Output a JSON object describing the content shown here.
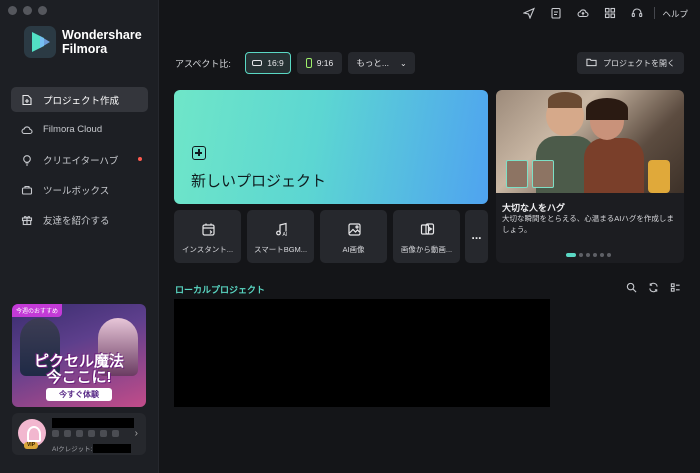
{
  "app": {
    "logo_line1": "Wondershare",
    "logo_line2": "Filmora",
    "help_label": "ヘルプ",
    "accent_color": "#5ad8c4"
  },
  "sidebar": {
    "items": [
      {
        "label": "プロジェクト作成",
        "icon": "project-create-icon",
        "active": true
      },
      {
        "label": "Filmora Cloud",
        "icon": "cloud-icon"
      },
      {
        "label": "クリエイターハブ",
        "icon": "lightbulb-icon",
        "notification": true
      },
      {
        "label": "ツールボックス",
        "icon": "toolbox-icon"
      },
      {
        "label": "友達を紹介する",
        "icon": "gift-icon"
      }
    ],
    "promo": {
      "badge": "今週のおすすめ",
      "headline_line1": "ピクセル魔法",
      "headline_line2": "今ここに!",
      "cta": "今すぐ体験"
    },
    "account": {
      "vip_badge": "VIP",
      "credit_label": "AIクレジット:"
    }
  },
  "toolbar_icons": [
    "send-icon",
    "clipboard-icon",
    "cloud-upload-icon",
    "grid-icon",
    "support-icon"
  ],
  "aspect": {
    "label": "アスペクト比:",
    "options": [
      {
        "label": "16:9",
        "selected": true
      },
      {
        "label": "9:16",
        "selected": false
      }
    ],
    "more_label": "もっと...",
    "open_project_label": "プロジェクトを開く"
  },
  "new_project": {
    "label": "新しいプロジェクト"
  },
  "features": [
    {
      "label": "インスタント...",
      "icon": "instant-mode-icon"
    },
    {
      "label": "スマートBGM...",
      "icon": "smart-bgm-icon"
    },
    {
      "label": "AI画像",
      "icon": "ai-image-icon"
    },
    {
      "label": "画像から動画...",
      "icon": "image-to-video-icon"
    }
  ],
  "more_features_label": "...",
  "banner": {
    "title": "大切な人をハグ",
    "description": "大切な瞬間をとらえる、心温まるAIハグを作成しましょう。",
    "slide_count": 6,
    "active_slide": 1
  },
  "local_projects": {
    "title": "ローカルプロジェクト"
  }
}
